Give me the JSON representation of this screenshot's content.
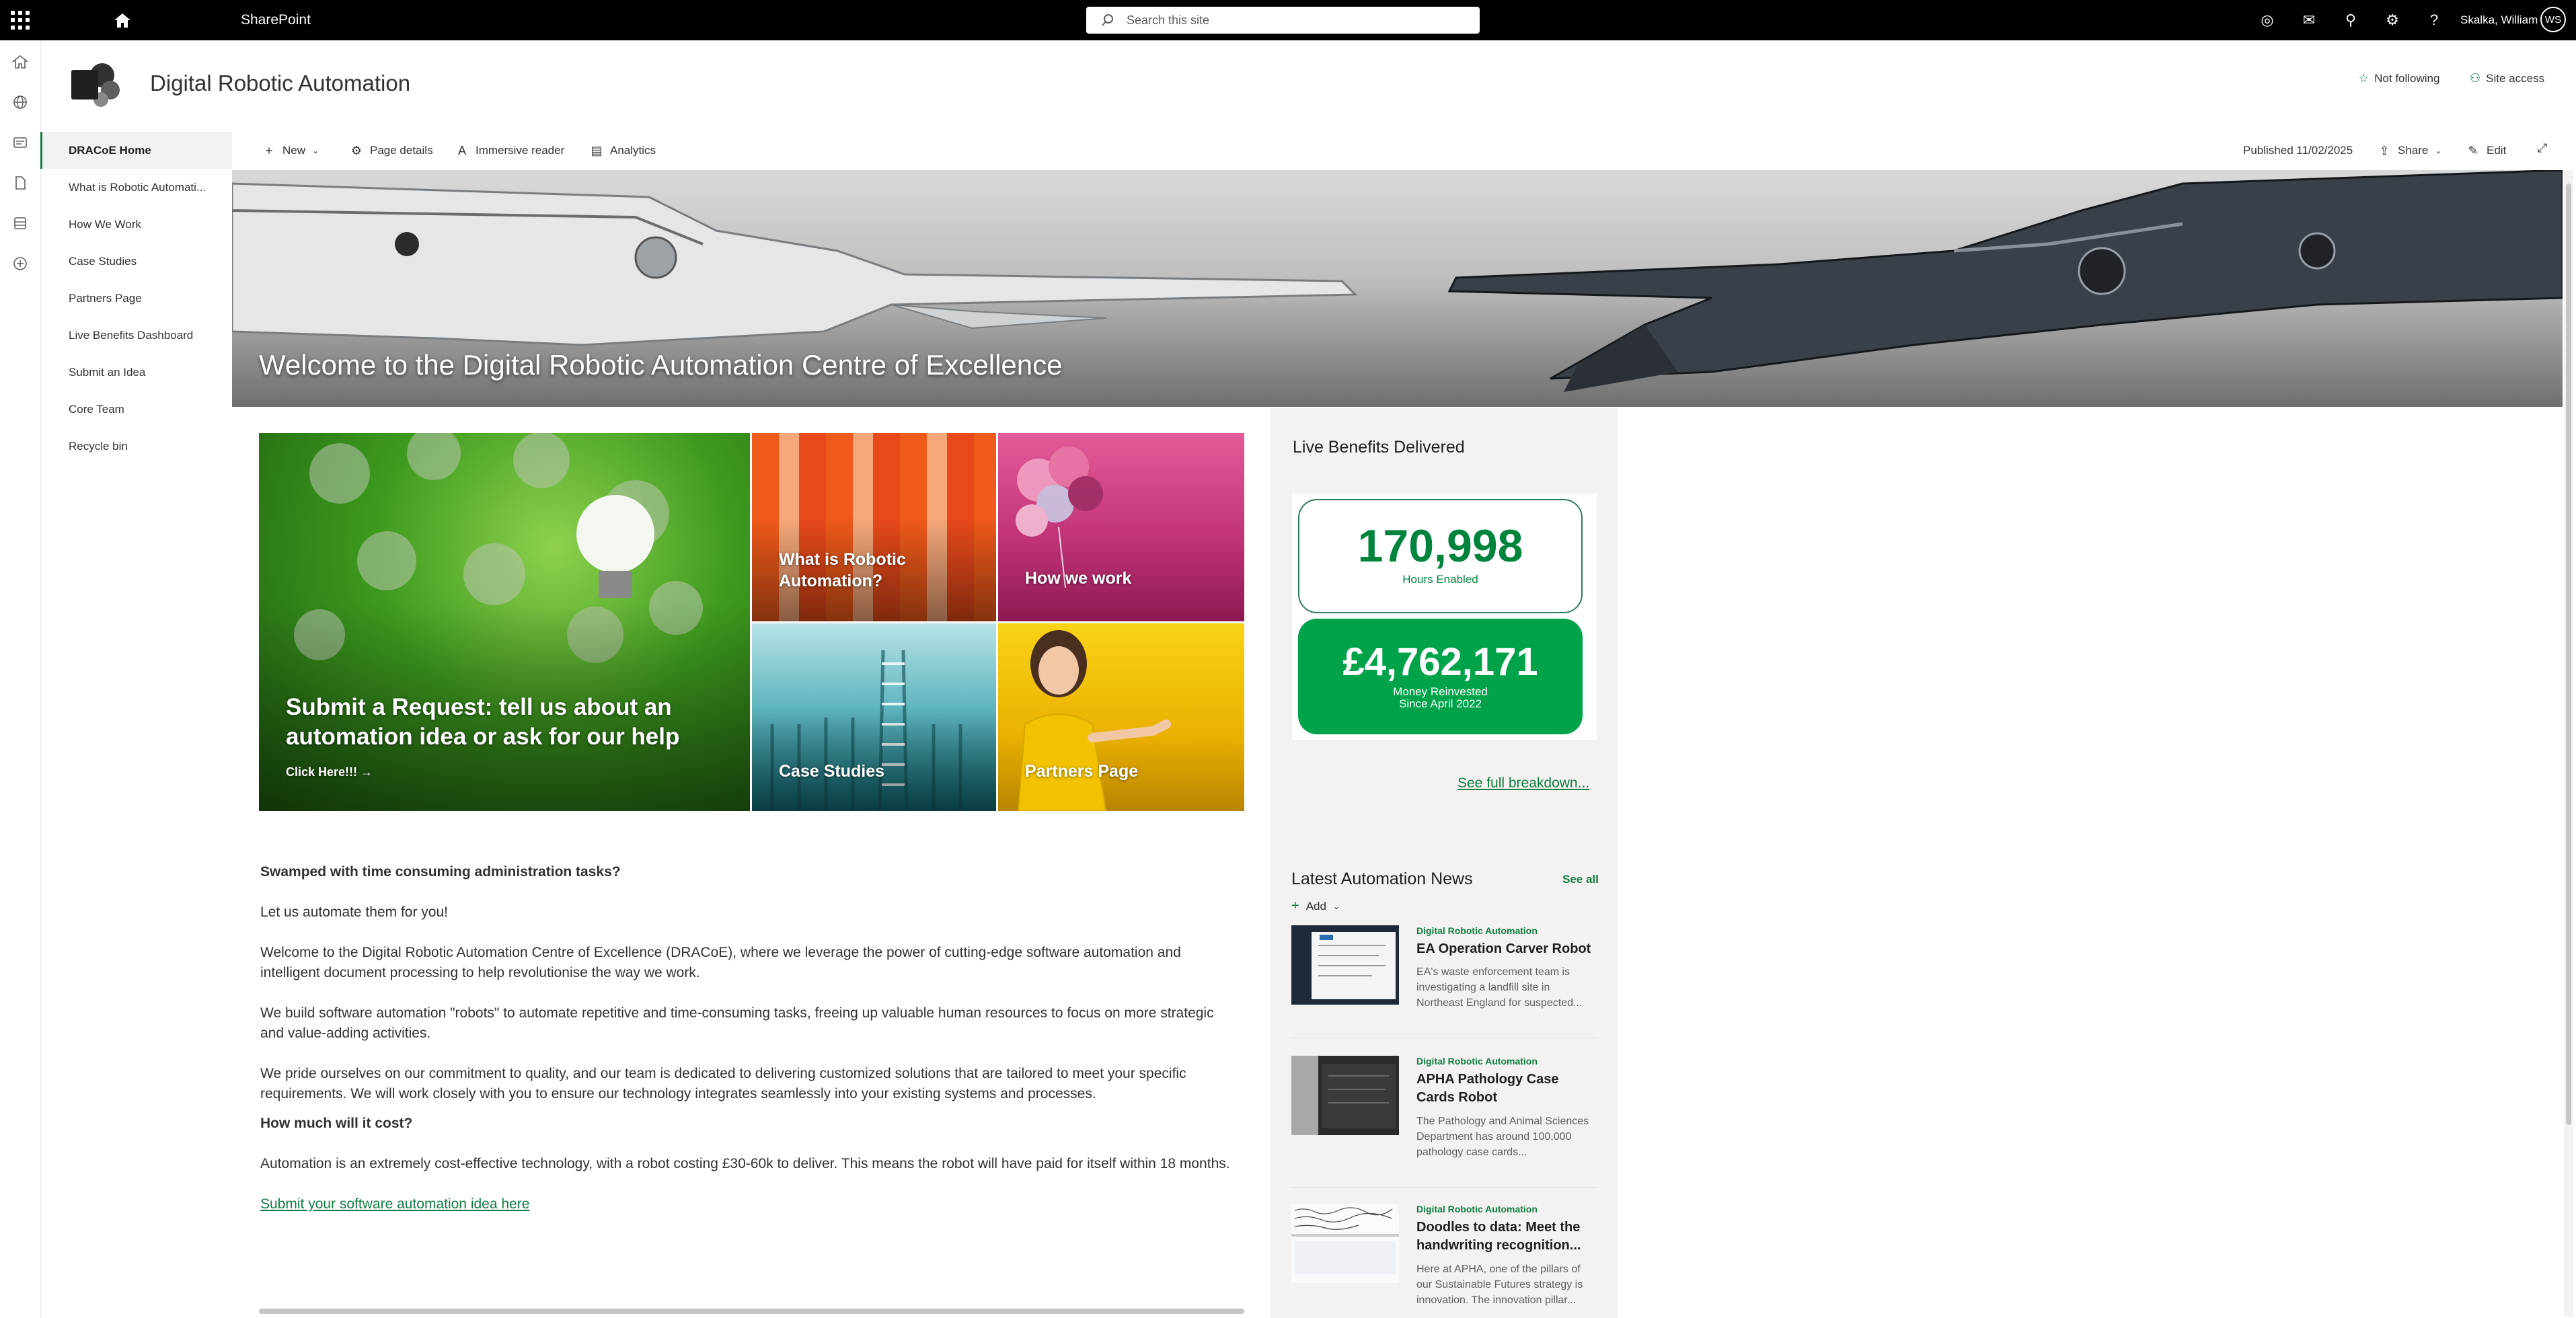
{
  "suite": {
    "app_name": "SharePoint",
    "search_placeholder": "Search this site",
    "user_name": "Skalka, William",
    "user_initials": "WS"
  },
  "site": {
    "title": "Digital Robotic Automation",
    "not_following": "Not following",
    "site_access": "Site access"
  },
  "nav": {
    "items": [
      {
        "label": "DRACoE Home"
      },
      {
        "label": "What is Robotic Automati..."
      },
      {
        "label": "How We Work"
      },
      {
        "label": "Case Studies"
      },
      {
        "label": "Partners Page"
      },
      {
        "label": "Live Benefits Dashboard"
      },
      {
        "label": "Submit an Idea"
      },
      {
        "label": "Core Team"
      },
      {
        "label": "Recycle bin"
      }
    ]
  },
  "commandbar": {
    "new": "New",
    "page_details": "Page details",
    "immersive_reader": "Immersive reader",
    "analytics": "Analytics",
    "published": "Published 11/02/2025",
    "share": "Share",
    "edit": "Edit"
  },
  "hero": {
    "title": "Welcome to the Digital Robotic Automation Centre of Excellence"
  },
  "tiles": {
    "main_title": "Submit a Request: tell us about an automation idea or ask for our help",
    "main_link": "Click Here!!! →",
    "rpa": "What is Robotic Automation?",
    "how": "How we work",
    "case": "Case Studies",
    "partners": "Partners Page"
  },
  "content": {
    "heading1": "Swamped with time consuming administration tasks?",
    "p1": "Let us automate them for you!",
    "p2": "Welcome to the Digital Robotic Automation Centre of Excellence (DRACoE), where we leverage the power of cutting-edge software automation and intelligent document processing to help revolutionise the way we work.",
    "p3": "We build software automation \"robots\" to automate repetitive and time-consuming tasks, freeing up valuable human resources to focus on more strategic and value-adding activities.",
    "p4": "We pride ourselves on our commitment to quality, and our team is dedicated to delivering customized solutions that are tailored to meet your specific requirements. We will work closely with you to ensure our technology integrates seamlessly into your existing systems and processes.",
    "heading2": "How much will it cost?",
    "p5": "Automation is an extremely cost-effective technology, with a robot costing £30-60k to deliver. This means the robot will have paid for itself within 18 months.",
    "link": "Submit your software automation idea here"
  },
  "benefits": {
    "title": "Live Benefits Delivered",
    "hours_value": "170,998",
    "hours_label": "Hours Enabled",
    "money_value": "£4,762,171",
    "money_label1": "Money Reinvested",
    "money_label2": "Since April 2022",
    "breakdown_link": "See full breakdown..."
  },
  "news": {
    "title": "Latest Automation News",
    "see_all": "See all",
    "add": "Add",
    "items": [
      {
        "source": "Digital Robotic Automation",
        "title": "EA Operation Carver Robot",
        "summary": "EA's waste enforcement team is investigating a landfill site in Northeast England for suspected..."
      },
      {
        "source": "Digital Robotic Automation",
        "title": "APHA Pathology Case Cards Robot",
        "summary": "The Pathology and Animal Sciences Department has around 100,000 pathology case cards..."
      },
      {
        "source": "Digital Robotic Automation",
        "title": "Doodles to data: Meet the handwriting recognition...",
        "summary": "Here at APHA, one of the pillars of our Sustainable Futures strategy is innovation. The innovation pillar..."
      }
    ]
  },
  "colors": {
    "accent": "#107c41",
    "kpi_green": "#00a34a",
    "suitebar": "#000000"
  }
}
